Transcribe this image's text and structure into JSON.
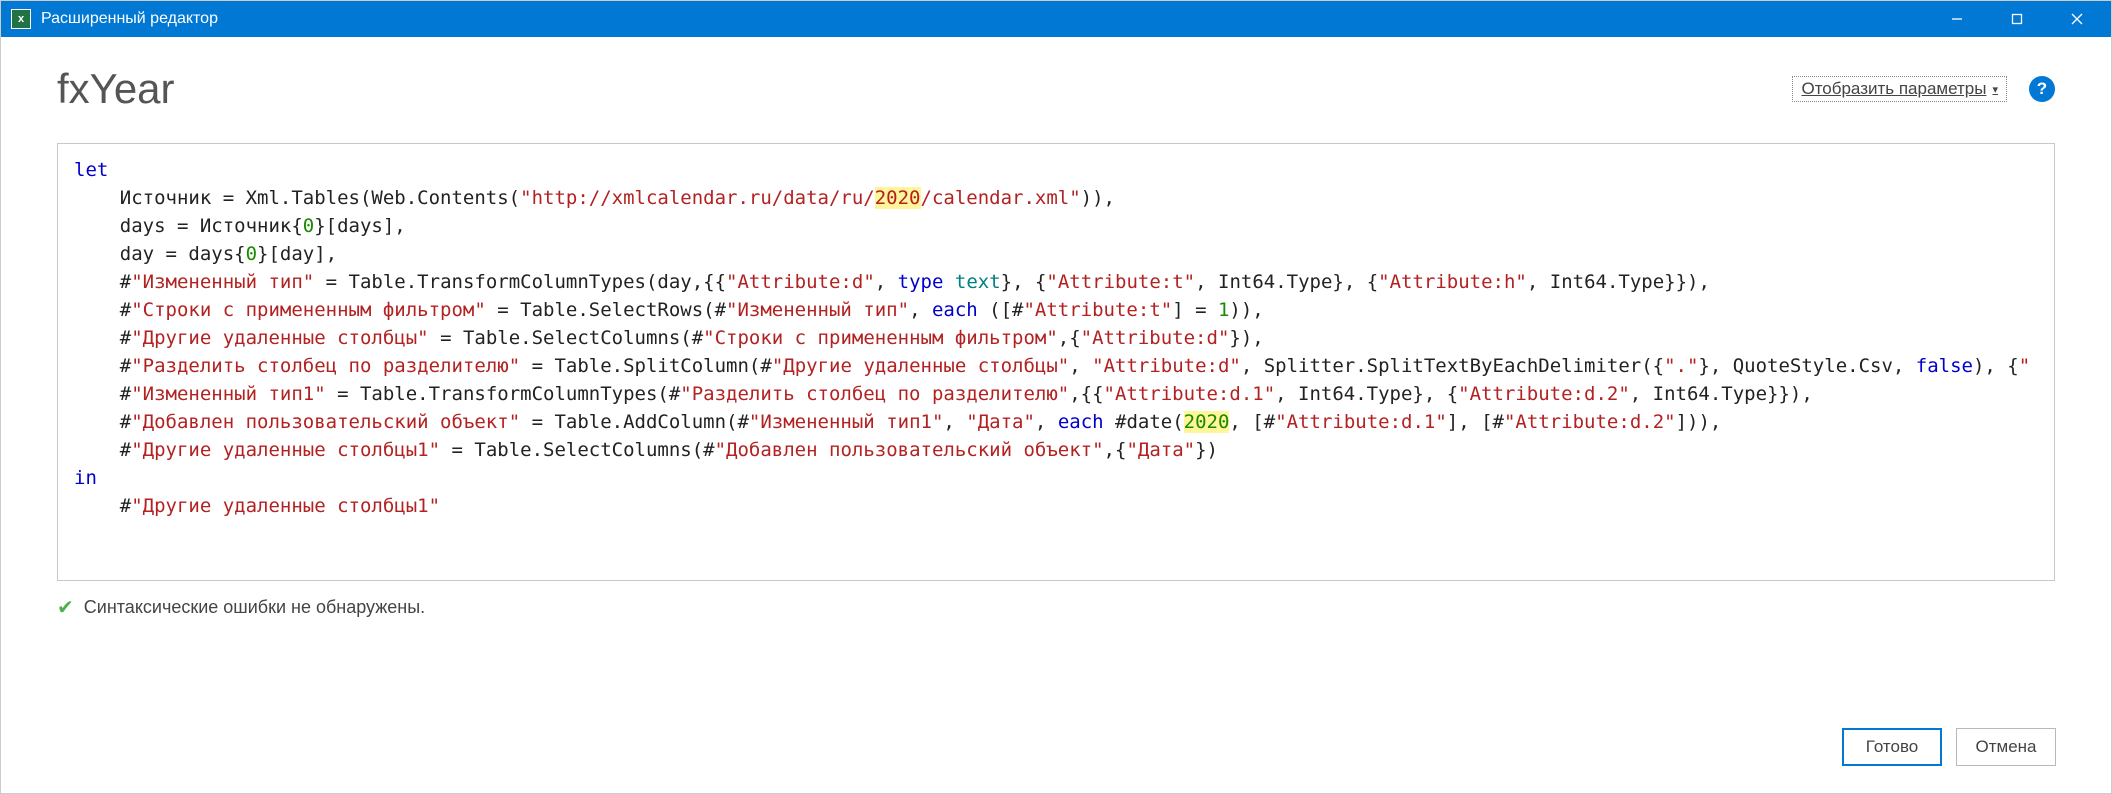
{
  "window": {
    "title": "Расширенный редактор",
    "excel_icon_text": "x"
  },
  "header": {
    "fx_name": "fxYear",
    "display_params": "Отобразить параметры"
  },
  "code": {
    "kw_let": "let",
    "l1_a": "    Источник = Xml.Tables(Web.Contents(",
    "l1_s1": "\"http://xmlcalendar.ru/data/ru/",
    "l1_hl": "2020",
    "l1_s2": "/calendar.xml\"",
    "l1_b": ")),",
    "l2_a": "    days = Источник{",
    "l2_n": "0",
    "l2_b": "}[days],",
    "l3_a": "    day = days{",
    "l3_n": "0",
    "l3_b": "}[day],",
    "l4_a": "    #",
    "l4_s1": "\"Измененный тип\"",
    "l4_b": " = Table.TransformColumnTypes(day,{{",
    "l4_s2": "\"Attribute:d\"",
    "l4_c": ", ",
    "l4_kw1": "type",
    "l4_sp": " ",
    "l4_kw2": "text",
    "l4_d": "}, {",
    "l4_s3": "\"Attribute:t\"",
    "l4_e": ", Int64.Type}, {",
    "l4_s4": "\"Attribute:h\"",
    "l4_f": ", Int64.Type}}),",
    "l5_a": "    #",
    "l5_s1": "\"Строки с примененным фильтром\"",
    "l5_b": " = Table.SelectRows(#",
    "l5_s2": "\"Измененный тип\"",
    "l5_c": ", ",
    "l5_kw": "each",
    "l5_d": " ([#",
    "l5_s3": "\"Attribute:t\"",
    "l5_e": "] = ",
    "l5_n": "1",
    "l5_f": ")),",
    "l6_a": "    #",
    "l6_s1": "\"Другие удаленные столбцы\"",
    "l6_b": " = Table.SelectColumns(#",
    "l6_s2": "\"Строки с примененным фильтром\"",
    "l6_c": ",{",
    "l6_s3": "\"Attribute:d\"",
    "l6_d": "}),",
    "l7_a": "    #",
    "l7_s1": "\"Разделить столбец по разделителю\"",
    "l7_b": " = Table.SplitColumn(#",
    "l7_s2": "\"Другие удаленные столбцы\"",
    "l7_c": ", ",
    "l7_s3": "\"Attribute:d\"",
    "l7_d": ", Splitter.SplitTextByEachDelimiter({",
    "l7_s4": "\".\"",
    "l7_e": "}, QuoteStyle.Csv, ",
    "l7_kw": "false",
    "l7_f": "), {",
    "l7_s5": "\"",
    "l8_a": "    #",
    "l8_s1": "\"Измененный тип1\"",
    "l8_b": " = Table.TransformColumnTypes(#",
    "l8_s2": "\"Разделить столбец по разделителю\"",
    "l8_c": ",{{",
    "l8_s3": "\"Attribute:d.1\"",
    "l8_d": ", Int64.Type}, {",
    "l8_s4": "\"Attribute:d.2\"",
    "l8_e": ", Int64.Type}}),",
    "l9_a": "    #",
    "l9_s1": "\"Добавлен пользовательский объект\"",
    "l9_b": " = Table.AddColumn(#",
    "l9_s2": "\"Измененный тип1\"",
    "l9_c": ", ",
    "l9_s3": "\"Дата\"",
    "l9_d": ", ",
    "l9_kw": "each",
    "l9_e": " #date(",
    "l9_n": "2020",
    "l9_f": ", [#",
    "l9_s4": "\"Attribute:d.1\"",
    "l9_g": "], [#",
    "l9_s5": "\"Attribute:d.2\"",
    "l9_h": "])),",
    "l10_a": "    #",
    "l10_s1": "\"Другие удаленные столбцы1\"",
    "l10_b": " = Table.SelectColumns(#",
    "l10_s2": "\"Добавлен пользовательский объект\"",
    "l10_c": ",{",
    "l10_s3": "\"Дата\"",
    "l10_d": "})",
    "kw_in": "in",
    "l12_a": "    #",
    "l12_s1": "\"Другие удаленные столбцы1\""
  },
  "status": {
    "text": "Синтаксические ошибки не обнаружены."
  },
  "buttons": {
    "ok": "Готово",
    "cancel": "Отмена"
  }
}
